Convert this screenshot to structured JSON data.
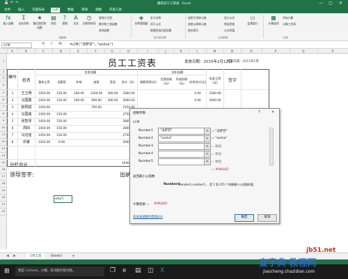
{
  "window": {
    "title": "最新员工工资表 - Excel",
    "minimize": "—",
    "restore": "▢",
    "close": "✕"
  },
  "tabs": [
    "文件",
    "插入",
    "页面布局",
    "公式",
    "数据",
    "审阅",
    "视图",
    "开发工具"
  ],
  "active_tab_index": 3,
  "ribbon": {
    "insert_function": "插入函数",
    "autosum": "自动求和",
    "recent": "最近使用的函数",
    "financial": "财务",
    "logical": "逻辑",
    "text": "文本",
    "datetime": "日期和时间",
    "lookup": "查找与引用",
    "math": "数学和三角函数",
    "other": "其他函数",
    "group_library": "函数库",
    "name_manager": "名称管理器",
    "define_name": "定义名称",
    "use_in_formula": "用于公式",
    "create_from_selection": "根据所选内容创建",
    "group_names": "定义的名称",
    "trace_precedents": "追踪引用单元格",
    "trace_dependents": "追踪从属单元格",
    "remove_arrows": "移去箭头",
    "show_formulas": "显示公式",
    "error_checking": "错误检查",
    "evaluate": "公式求值",
    "group_audit": "公式审核",
    "watch_window": "监视窗口",
    "calc_options": "计算选项",
    "calc_now": "开始计算",
    "calc_sheet": "计算工作表",
    "group_calc": "计算"
  },
  "formula_bar": {
    "name_box": "LCM",
    "cancel": "✕",
    "enter": "✓",
    "fx": "fx",
    "formula": "=LCM(\"法萨芬\",\"asdsa\")"
  },
  "columns": [
    "A",
    "B",
    "C",
    "D",
    "E",
    "F",
    "G",
    "H",
    "I",
    "J",
    "K",
    "L",
    "M",
    "N",
    "O",
    "P",
    "Q",
    "R"
  ],
  "rows": [
    "1",
    "2",
    "3",
    "4",
    "5",
    "6",
    "7",
    "8",
    "9",
    "10",
    "11",
    "12",
    "13",
    "14",
    "15",
    "16",
    "17",
    "18",
    "19",
    "20",
    "21",
    "22"
  ],
  "sheet": {
    "title": "员工工资表",
    "issue_date": "发放日期：2015年2月12日",
    "month": "所属日期：2015年1月",
    "h_no": "编号",
    "h_name": "姓名",
    "h_payable": "应发金额",
    "h_deduct": "应扣金额",
    "h_actual": "实发工资(元)",
    "h_sign": "签字",
    "h_base": "基本工资",
    "h_full": "全勤奖",
    "h_subsidy": "补助",
    "h_overtime": "加班",
    "h_bonus": "奖金",
    "h_total": "合计（元）",
    "h_leave": "请假扣款(元)",
    "h_late": "迟到扣款(元)",
    "h_early": "早退扣款(元)",
    "h_dtotal": "应扣合计(元)",
    "employees": [
      {
        "no": "1",
        "name": "王卫明",
        "base": "1450.00",
        "full": "150.00",
        "sub": "200.00",
        "ot": "1200.00",
        "bonus": "300.00",
        "total": "3300.00",
        "dtotal": "0.00",
        "actual": "3300.00"
      },
      {
        "no": "2",
        "name": "马国鑫",
        "base": "1450.00",
        "full": "150.00",
        "sub": "200.00",
        "ot": "900.00",
        "bonus": "300.00",
        "total": "3000.00",
        "dtotal": "0.00",
        "actual": "3000.00"
      },
      {
        "no": "3",
        "name": "欧阳斌",
        "base": "1450.00",
        "full": "",
        "sub": "",
        "ot": "700.00",
        "bonus": "",
        "total": "2150.00",
        "dtotal": "",
        "actual": ""
      },
      {
        "no": "4",
        "name": "马国威",
        "base": "1450.00",
        "full": "150.00",
        "sub": "",
        "ot": "",
        "bonus": "",
        "total": "2750.00",
        "dtotal": "",
        "actual": ""
      },
      {
        "no": "5",
        "name": "张智琴",
        "base": "1450.00",
        "full": "150.00",
        "sub": "",
        "ot": "",
        "bonus": "",
        "total": "2800.00",
        "dtotal": "",
        "actual": ""
      },
      {
        "no": "6",
        "name": "周四",
        "base": "1450.00",
        "full": "150.00",
        "sub": "",
        "ot": "",
        "bonus": "",
        "total": "2800.00",
        "dtotal": "",
        "actual": ""
      },
      {
        "no": "7",
        "name": "马迈迪",
        "base": "1450.00",
        "full": "150.00",
        "sub": "",
        "ot": "",
        "bonus": "",
        "total": "2750.00",
        "dtotal": "",
        "actual": ""
      },
      {
        "no": "8",
        "name": "邓睿",
        "base": "1450.00",
        "full": "0.00",
        "sub": "",
        "ot": "",
        "bonus": "",
        "total": "2600.00",
        "dtotal": "",
        "actual": ""
      }
    ],
    "subtotal_label": "分栏合计",
    "subtotal_value": "19300.00",
    "leader_sign": "领导签字:",
    "cashier_sign": "出纳",
    "active_cell_text": "sdsa\")"
  },
  "dialog": {
    "title": "函数参数",
    "function_name": "LCM",
    "args": [
      {
        "label": "Number1",
        "value": "\"法萨芬\"",
        "result": "= \"法萨芬\""
      },
      {
        "label": "Number2",
        "value": "\"asdsa\"",
        "result": "= \"asdsa\""
      },
      {
        "label": "Number3",
        "value": "",
        "result": "= 数值"
      },
      {
        "label": "Number4",
        "value": "",
        "result": "= 数值"
      },
      {
        "label": "Number5",
        "value": "",
        "result": "= 数值"
      }
    ],
    "overall_result": "= #VALUE!",
    "description": "返回最小公倍数",
    "arg_help_label": "Number4:",
    "arg_help_text": "number1,number2,... 是 1 到 255 个求解最小公倍数的值",
    "calc_result_label": "计算结果 =",
    "calc_result_value": "#VALUE!",
    "help_link": "有关该函数的帮助(H)",
    "ok": "确定",
    "cancel": "取消",
    "help_icon": "?",
    "close_icon": "✕"
  },
  "sheet_tabs": [
    "5月工资",
    "Sheet3"
  ],
  "add_sheet": "+",
  "taskbar": {
    "search": "我是 Cortana，小娜。有问题尽管问我。"
  },
  "watermark": {
    "site": "jb51.net",
    "brand": "查字典 教程网",
    "url": "jiaocheng.chazidian.com"
  },
  "colors": {
    "excel_green": "#217346",
    "error_red": "#c00000"
  }
}
